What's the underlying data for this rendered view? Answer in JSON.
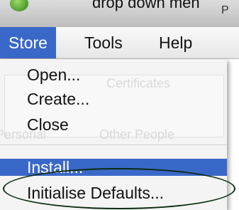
{
  "caption": "drop down men",
  "titlebar": {
    "partial_title": "P"
  },
  "menubar": {
    "menus": [
      {
        "label": "Store",
        "open": true
      },
      {
        "label": "Tools",
        "open": false
      },
      {
        "label": "Help",
        "open": false
      }
    ]
  },
  "store_menu": {
    "items": [
      {
        "label": "Open..."
      },
      {
        "label": "Create..."
      },
      {
        "label": "Close"
      },
      {
        "label": "Install...",
        "highlighted": true
      },
      {
        "label": "Initialise Defaults..."
      }
    ]
  },
  "background_window": {
    "tab_certificates": "Certificates",
    "tab_personal": "Personal",
    "tab_other_people": "Other People"
  },
  "colors": {
    "selection": "#3a68c8",
    "menu_background": "#f4f4f4",
    "annotation": "#0b2a10"
  }
}
